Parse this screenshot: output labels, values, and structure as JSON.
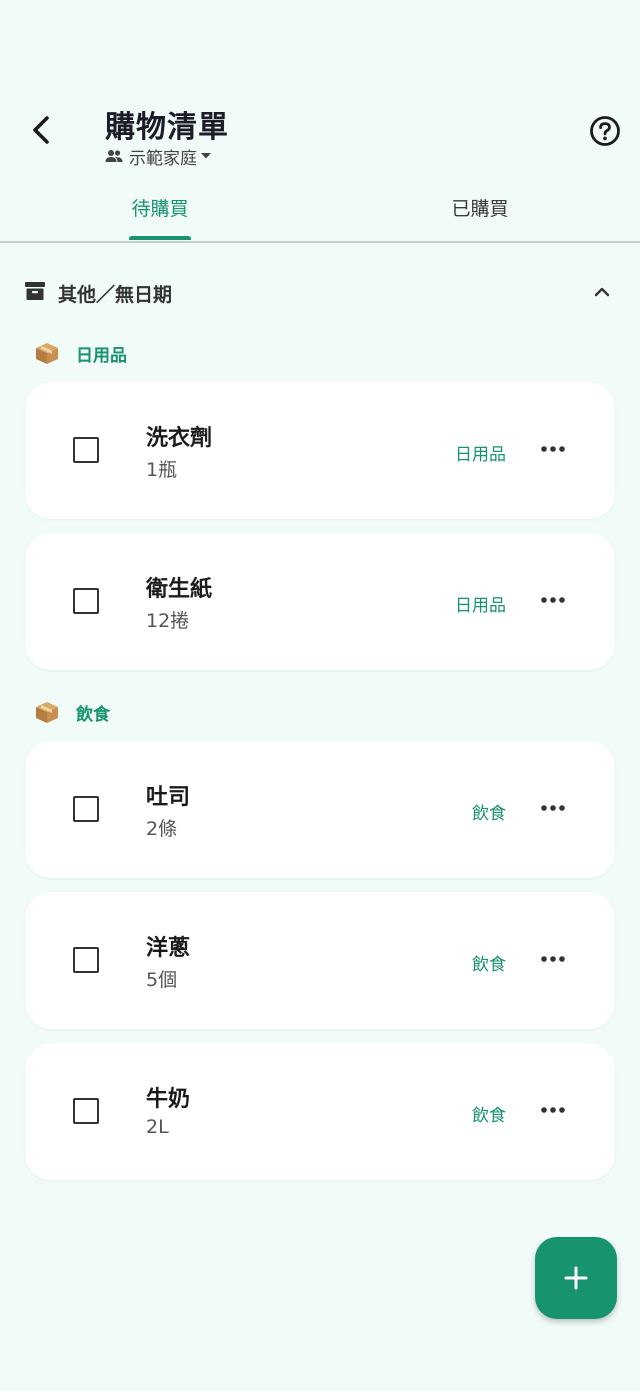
{
  "header": {
    "title": "購物清單",
    "family": "示範家庭"
  },
  "tabs": [
    {
      "label": "待購買",
      "active": true
    },
    {
      "label": "已購買",
      "active": false
    }
  ],
  "section": {
    "label": "其他／無日期",
    "expanded": true
  },
  "categories": [
    {
      "label": "日用品",
      "items": [
        {
          "name": "洗衣劑",
          "qty": "1瓶",
          "tag": "日用品",
          "checked": false
        },
        {
          "name": "衛生紙",
          "qty": "12捲",
          "tag": "日用品",
          "checked": false
        }
      ]
    },
    {
      "label": "飲食",
      "items": [
        {
          "name": "吐司",
          "qty": "2條",
          "tag": "飲食",
          "checked": false
        },
        {
          "name": "洋蔥",
          "qty": "5個",
          "tag": "飲食",
          "checked": false
        },
        {
          "name": "牛奶",
          "qty": "2L",
          "tag": "飲食",
          "checked": false
        }
      ]
    }
  ],
  "colors": {
    "accent": "#17936f",
    "background": "#f1fbf7",
    "card": "#ffffff"
  },
  "icons": {
    "back": "arrow-back-icon",
    "help": "help-circle-icon",
    "family": "people-icon",
    "dropdown": "caret-down-icon",
    "section": "archive-icon",
    "collapse": "chevron-up-icon",
    "category": "package-icon",
    "more": "more-horizontal-icon",
    "add": "plus-icon"
  }
}
